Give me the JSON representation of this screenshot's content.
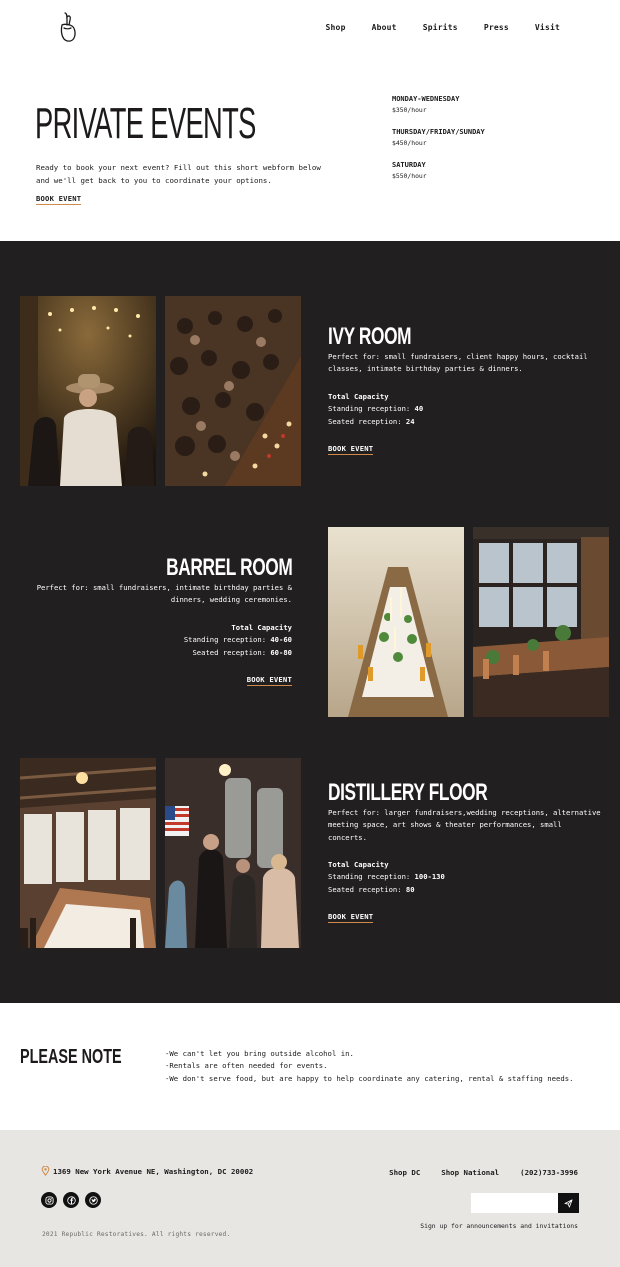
{
  "nav": {
    "items": [
      "Shop",
      "About",
      "Spirits",
      "Press",
      "Visit"
    ]
  },
  "hero": {
    "title": "PRIVATE EVENTS",
    "description": "Ready to book your next event? Fill out this short webform below and we'll get back to you to coordinate your options.",
    "book_label": "BOOK EVENT"
  },
  "rates": [
    {
      "day": "MONDAY-WEDNESDAY",
      "price": "$350/hour"
    },
    {
      "day": "THURSDAY/FRIDAY/SUNDAY",
      "price": "$450/hour"
    },
    {
      "day": "SATURDAY",
      "price": "$550/hour"
    }
  ],
  "rooms": [
    {
      "name": "IVY ROOM",
      "description": "Perfect for: small fundraisers, client happy hours, cocktail classes, intimate birthday parties & dinners.",
      "capacity_label": "Total Capacity",
      "standing_label": "Standing reception: ",
      "standing": "40",
      "seated_label": "Seated reception: ",
      "seated": "24",
      "book_label": "BOOK EVENT"
    },
    {
      "name": "BARREL ROOM",
      "description": "Perfect for: small fundraisers, intimate birthday parties & dinners, wedding ceremonies.",
      "capacity_label": "Total Capacity",
      "standing_label": "Standing reception: ",
      "standing": "40-60",
      "seated_label": "Seated reception: ",
      "seated": "60-80",
      "book_label": "BOOK EVENT"
    },
    {
      "name": "DISTILLERY FLOOR",
      "description": "Perfect for: larger fundraisers,wedding receptions, alternative meeting space, art shows & theater performances, small concerts.",
      "capacity_label": "Total Capacity",
      "standing_label": "Standing reception: ",
      "standing": "100-130",
      "seated_label": "Seated reception: ",
      "seated": "80",
      "book_label": "BOOK EVENT"
    }
  ],
  "note": {
    "title": "PLEASE NOTE",
    "items": [
      "-We can't let you bring outside alcohol in.",
      "-Rentals are often needed for events.",
      "-We don't serve food, but are happy to help coordinate any catering, rental & staffing needs."
    ]
  },
  "footer": {
    "address": "1369 New York Avenue NE, Washington, DC 20002",
    "links": [
      "Shop DC",
      "Shop National",
      "(202)733-3996"
    ],
    "signup_text": "Sign up for announcements and invitations",
    "copyright": "2021 Republic Restoratives. All rights reserved.",
    "social_icons": [
      "instagram-icon",
      "facebook-icon",
      "twitter-icon"
    ]
  },
  "colors": {
    "dark_bg": "#221f20",
    "accent_underline": "#d08a4a",
    "footer_bg": "#e7e6e3"
  }
}
